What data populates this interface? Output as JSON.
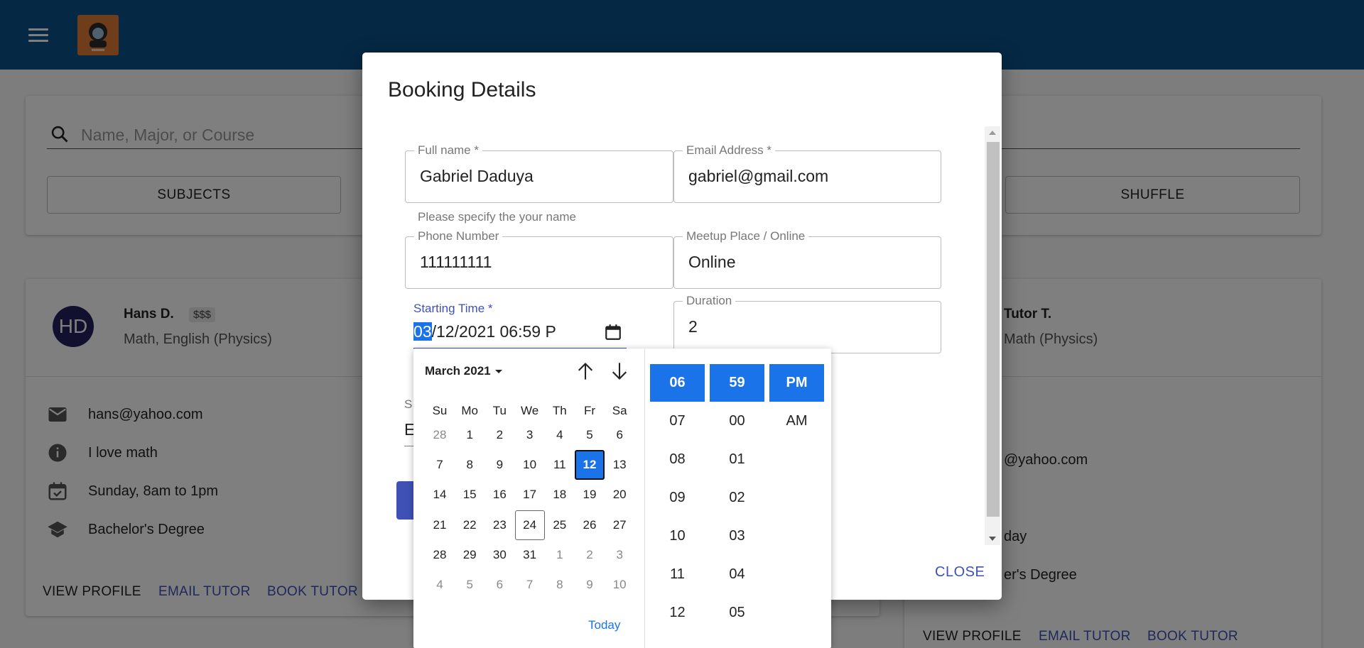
{
  "app": {
    "logo_alt": "logo",
    "search_placeholder": "Name, Major, or Course",
    "buttons": {
      "subjects": "SUBJECTS",
      "shuffle": "SHUFFLE"
    }
  },
  "tutors": [
    {
      "initials": "HD",
      "name": "Hans D.",
      "price": "$$$",
      "subjects": "Math, English (Physics)",
      "email": "hans@yahoo.com",
      "bio": "I love math",
      "availability": "Sunday, 8am to 1pm",
      "degree": "Bachelor's Degree",
      "actions": {
        "view": "VIEW PROFILE",
        "email": "EMAIL TUTOR",
        "book": "BOOK TUTOR"
      }
    },
    {
      "name": "Tutor T.",
      "subjects": "Math (Physics)",
      "email_partial": "@yahoo.com",
      "availability_partial": "day",
      "degree_partial": "er's Degree",
      "actions": {
        "view": "VIEW PROFILE",
        "email": "EMAIL TUTOR",
        "book": "BOOK TUTOR"
      }
    }
  ],
  "dialog": {
    "title": "Booking Details",
    "fields": {
      "full_name": {
        "label": "Full name *",
        "value": "Gabriel Daduya",
        "helper": "Please specify the your name"
      },
      "email": {
        "label": "Email Address *",
        "value": "gabriel@gmail.com"
      },
      "phone": {
        "label": "Phone Number",
        "value": "111111111"
      },
      "meetup": {
        "label": "Meetup Place / Online",
        "value": "Online"
      },
      "starting_time": {
        "label": "Starting Time *",
        "segment_month": "03",
        "rest": "/12/2021 06:59 P"
      },
      "duration": {
        "label": "Duration",
        "value": "2"
      },
      "hidden_label": "S",
      "hidden_value": "E"
    },
    "close_label": "CLOSE"
  },
  "datepicker": {
    "month_label": "March 2021",
    "weekdays": [
      "Su",
      "Mo",
      "Tu",
      "We",
      "Th",
      "Fr",
      "Sa"
    ],
    "weeks": [
      [
        "28",
        "1",
        "2",
        "3",
        "4",
        "5",
        "6"
      ],
      [
        "7",
        "8",
        "9",
        "10",
        "11",
        "12",
        "13"
      ],
      [
        "14",
        "15",
        "16",
        "17",
        "18",
        "19",
        "20"
      ],
      [
        "21",
        "22",
        "23",
        "24",
        "25",
        "26",
        "27"
      ],
      [
        "28",
        "29",
        "30",
        "31",
        "1",
        "2",
        "3"
      ],
      [
        "4",
        "5",
        "6",
        "7",
        "8",
        "9",
        "10"
      ]
    ],
    "selected_day": "12",
    "today_day": "24",
    "today_label": "Today",
    "hours": [
      "06",
      "07",
      "08",
      "09",
      "10",
      "11",
      "12"
    ],
    "minutes": [
      "59",
      "00",
      "01",
      "02",
      "03",
      "04",
      "05"
    ],
    "meridiem": [
      "PM",
      "AM"
    ],
    "selected": {
      "hour": "06",
      "minute": "59",
      "meridiem": "PM"
    }
  },
  "colors": {
    "appbar": "#0b5189",
    "accent": "#1a73e8",
    "primary": "#3f51b5",
    "avatar": "#23235e"
  }
}
